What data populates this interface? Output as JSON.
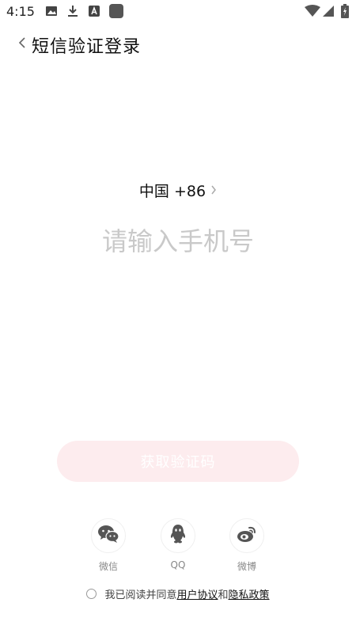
{
  "status_bar": {
    "time": "4:15",
    "left_icons": [
      "image-icon",
      "download-icon",
      "app-a-icon",
      "app-square-icon"
    ],
    "right_icons": [
      "wifi-icon",
      "signal-icon",
      "battery-icon"
    ]
  },
  "header": {
    "title": "短信验证登录",
    "back_icon": "chevron-left-icon"
  },
  "login": {
    "country_code": "中国 +86",
    "phone_placeholder": "请输入手机号",
    "get_code_label": "获取验证码"
  },
  "social": [
    {
      "label": "微信",
      "icon": "wechat-icon"
    },
    {
      "label": "QQ",
      "icon": "qq-icon"
    },
    {
      "label": "微博",
      "icon": "weibo-icon"
    }
  ],
  "agreement": {
    "prefix": "我已阅读并同意",
    "user_agreement": "用户协议",
    "conjunction": "和",
    "privacy_policy": "隐私政策"
  },
  "colors": {
    "button_bg": "#fdecee",
    "button_text": "#ffffff",
    "placeholder": "#c9c9c9",
    "icon": "#555555"
  }
}
